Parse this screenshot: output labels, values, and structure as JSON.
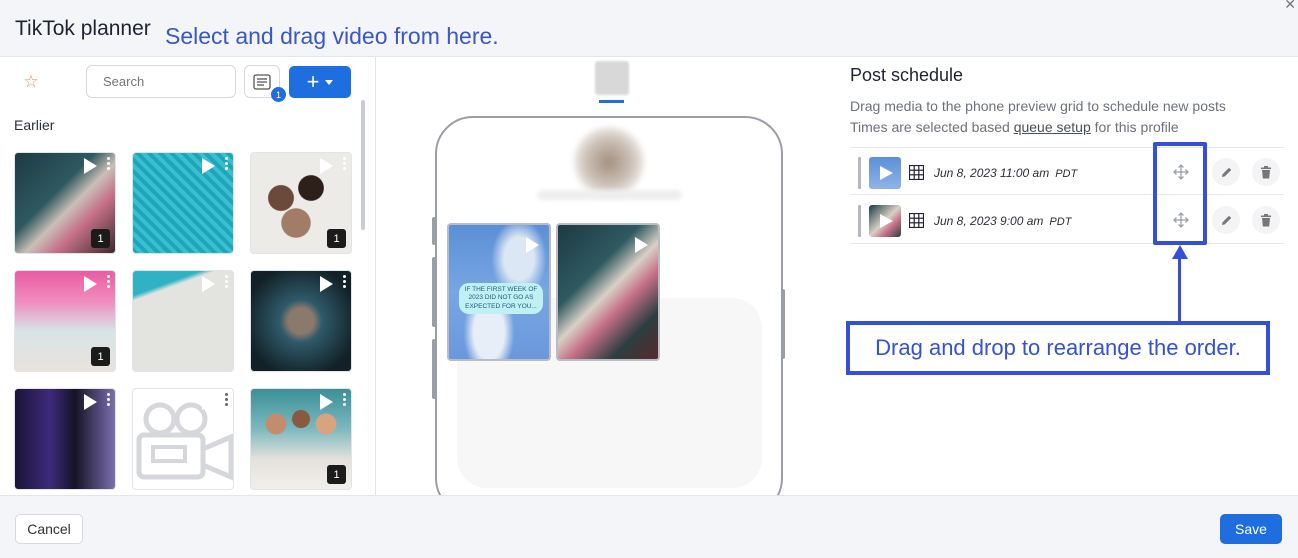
{
  "header": {
    "title": "TikTok planner",
    "hint": "Select and drag video from here."
  },
  "left": {
    "search_placeholder": "Search",
    "filter_badge": "1",
    "add_label": "+",
    "section_label": "Earlier",
    "thumbs": [
      {
        "count": "1"
      },
      {
        "count": ""
      },
      {
        "count": "1"
      },
      {
        "count": "1"
      },
      {
        "count": ""
      },
      {
        "count": ""
      },
      {
        "count": ""
      },
      {
        "count": ""
      },
      {
        "count": "1"
      }
    ]
  },
  "preview": {
    "tile_text": "IF THE FIRST WEEK OF 2023 DID NOT GO AS EXPECTED FOR YOU..."
  },
  "schedule": {
    "title": "Post schedule",
    "desc_line1": "Drag media to the phone preview grid to schedule new posts",
    "desc_line2_prefix": "Times are selected based ",
    "desc_line2_link": "queue setup",
    "desc_line2_suffix": " for this profile",
    "rows": [
      {
        "datetime": "Jun 8, 2023 11:00 am",
        "tz": "PDT"
      },
      {
        "datetime": "Jun 8, 2023 9:00 am",
        "tz": "PDT"
      }
    ],
    "callout": "Drag and drop to rearrange the order."
  },
  "footer": {
    "cancel_label": "Cancel",
    "save_label": "Save"
  },
  "colors": {
    "accent": "#1e6ee0",
    "annotation": "#3550d8"
  }
}
